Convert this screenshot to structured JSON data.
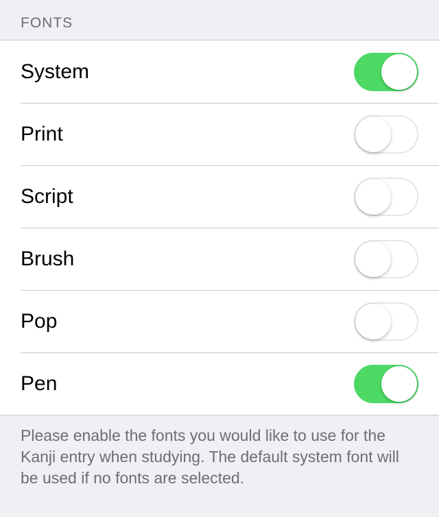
{
  "section": {
    "header": "FONTS",
    "footer": "Please enable the fonts you would like to use for the Kanji entry when studying.  The default system font will be used if no fonts are selected."
  },
  "fonts": [
    {
      "label": "System",
      "enabled": true
    },
    {
      "label": "Print",
      "enabled": false
    },
    {
      "label": "Script",
      "enabled": false
    },
    {
      "label": "Brush",
      "enabled": false
    },
    {
      "label": "Pop",
      "enabled": false
    },
    {
      "label": "Pen",
      "enabled": true
    }
  ]
}
